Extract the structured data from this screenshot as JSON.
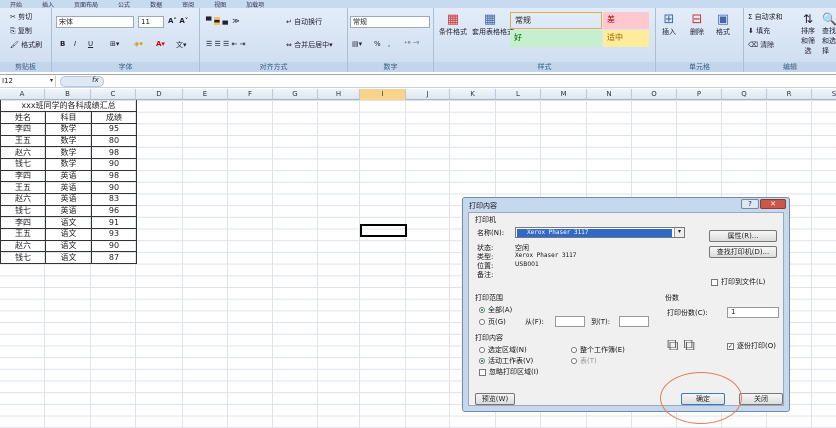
{
  "ribbon": {
    "tabs": [
      "开始",
      "插入",
      "页面布局",
      "公式",
      "数据",
      "审阅",
      "视图",
      "加载项"
    ],
    "clipboard": {
      "cut": "剪切",
      "copy": "复制",
      "format_painter": "格式刷",
      "label": "剪贴板"
    },
    "font": {
      "name": "宋体",
      "size": "11",
      "bold": "B",
      "italic": "I",
      "underline": "U",
      "label": "字体"
    },
    "alignment": {
      "wrap": "自动换行",
      "merge": "合并后居中",
      "label": "对齐方式"
    },
    "number": {
      "format": "常规",
      "percent": "%",
      "comma": ",",
      "label": "数字"
    },
    "styles": {
      "conditional": "条件格式",
      "table": "套用表格格式",
      "cells": [
        {
          "label": "常规",
          "bg": "#ffffff"
        },
        {
          "label": "差",
          "bg": "#ffc7ce"
        },
        {
          "label": "好",
          "bg": "#c6efce"
        },
        {
          "label": "适中",
          "bg": "#ffeb9c"
        }
      ],
      "label": "样式"
    },
    "cells": {
      "insert": "插入",
      "delete": "删除",
      "format": "格式",
      "label": "单元格"
    },
    "editing": {
      "autosum": "自动求和",
      "fill": "填充",
      "clear": "清除",
      "sort": "排序和筛选",
      "find": "查找和选择",
      "label": "编辑"
    }
  },
  "formula_bar": {
    "name_box": "I12",
    "fx": "fx",
    "value": ""
  },
  "columns": [
    "A",
    "B",
    "C",
    "D",
    "E",
    "F",
    "G",
    "H",
    "I",
    "J",
    "K",
    "L",
    "M",
    "N",
    "O",
    "P",
    "Q",
    "R",
    "S"
  ],
  "selected_column": "I",
  "sheet": {
    "title": "xxx班同学的各科成绩汇总",
    "headers": [
      "姓名",
      "科目",
      "成绩"
    ],
    "rows": [
      [
        "李四",
        "数学",
        "95"
      ],
      [
        "王五",
        "数学",
        "80"
      ],
      [
        "赵六",
        "数学",
        "98"
      ],
      [
        "钱七",
        "数学",
        "90"
      ],
      [
        "李四",
        "英语",
        "98"
      ],
      [
        "王五",
        "英语",
        "90"
      ],
      [
        "赵六",
        "英语",
        "83"
      ],
      [
        "钱七",
        "英语",
        "96"
      ],
      [
        "李四",
        "语文",
        "91"
      ],
      [
        "王五",
        "语文",
        "93"
      ],
      [
        "赵六",
        "语文",
        "90"
      ],
      [
        "钱七",
        "语文",
        "87"
      ]
    ]
  },
  "dialog": {
    "title": "打印内容",
    "printer_group": "打印机",
    "name_label": "名称(N):",
    "printer_name": "Xerox Phaser 3117",
    "status_label": "状态:",
    "status": "空闲",
    "type_label": "类型:",
    "type": "Xerox Phaser 3117",
    "where_label": "位置:",
    "where": "USB001",
    "comment_label": "备注:",
    "properties": "属性(R)...",
    "find_printer": "查找打印机(D)...",
    "print_to_file": "打印到文件(L)",
    "range_group": "打印范围",
    "all": "全部(A)",
    "pages": "页(G)",
    "from": "从(F):",
    "to": "到(T):",
    "what_group": "打印内容",
    "selection": "选定区域(N)",
    "entire_workbook": "整个工作簿(E)",
    "active_sheets": "活动工作表(V)",
    "table": "表(T)",
    "ignore_areas": "忽略打印区域(I)",
    "copies_group": "份数",
    "copies_label": "打印份数(C):",
    "copies": "1",
    "collate": "逐份打印(O)",
    "preview": "预览(W)",
    "ok": "确定",
    "cancel": "关闭"
  }
}
